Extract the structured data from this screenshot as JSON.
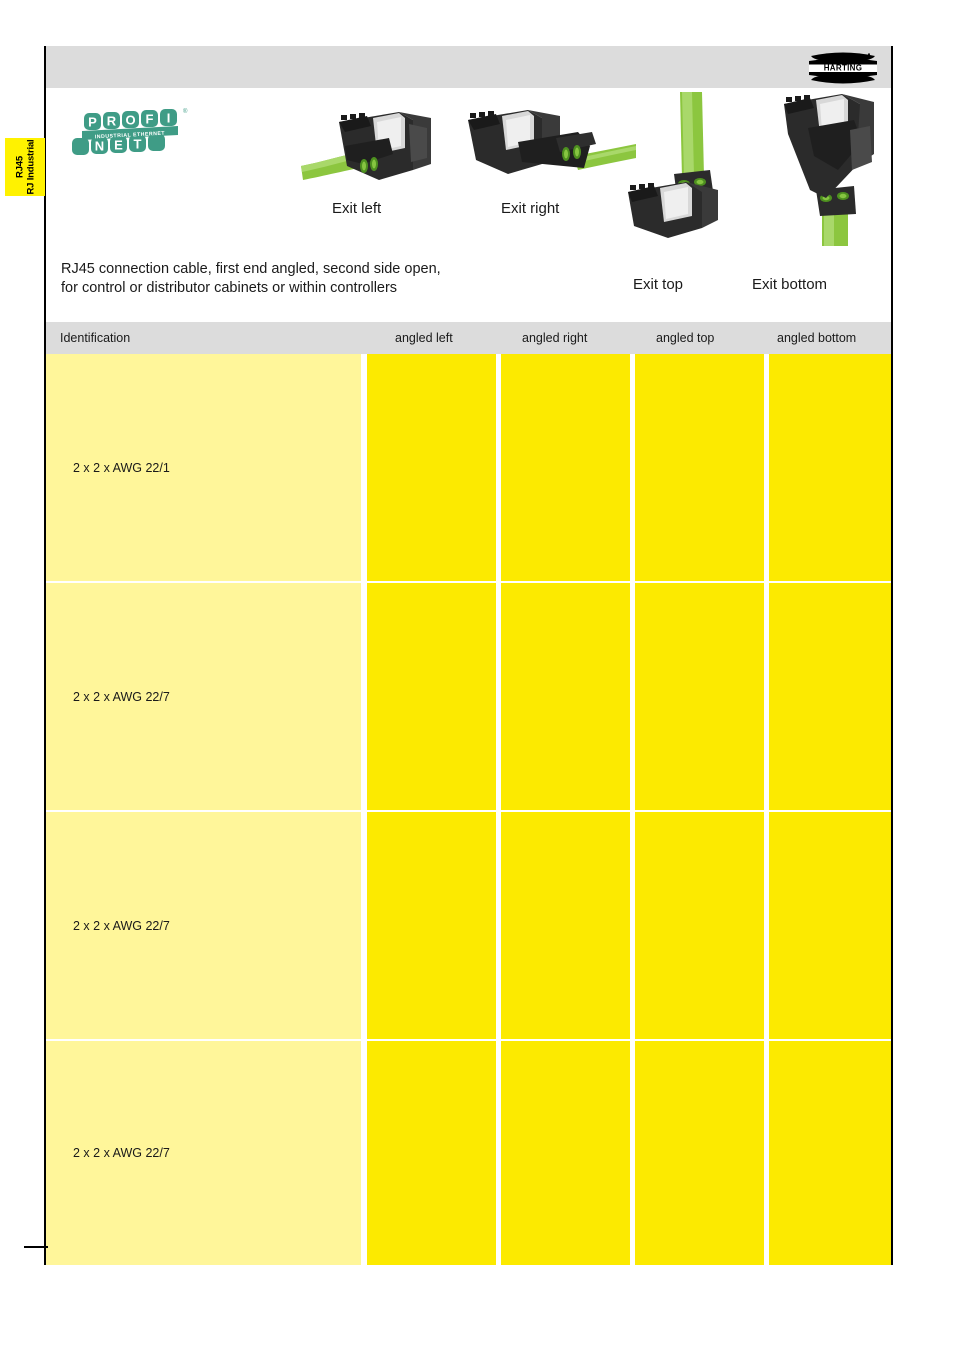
{
  "brand": {
    "logo_text": "HARTING",
    "accent_yellow": "#fcea00",
    "light_yellow": "#fff69a",
    "header_gray": "#dcdcdc",
    "profinet_green": "#3f9c86"
  },
  "side_tab": {
    "line1": "RJ45",
    "line2": "RJ Industrial"
  },
  "profinet": {
    "line1": "PROFI",
    "line2": "NET",
    "subtitle": "INDUSTRIAL ETHERNET",
    "registered_mark": "®",
    "letters_top": [
      "P",
      "R",
      "O",
      "F",
      "I"
    ],
    "letters_bottom": [
      "N",
      "E",
      "T"
    ]
  },
  "product": {
    "description_line1": "RJ45 connection cable, first end angled, second side open,",
    "description_line2": "for control or distributor cabinets or within controllers",
    "images": [
      {
        "name": "exit-left",
        "label": "Exit left"
      },
      {
        "name": "exit-right",
        "label": "Exit right"
      },
      {
        "name": "exit-top",
        "label": "Exit top"
      },
      {
        "name": "exit-bottom",
        "label": "Exit bottom"
      }
    ]
  },
  "table": {
    "headers": [
      "Identification",
      "angled left",
      "angled right",
      "angled top",
      "angled bottom"
    ],
    "rows": [
      {
        "identification": "2 x 2 x AWG 22/1",
        "angled_left": "",
        "angled_right": "",
        "angled_top": "",
        "angled_bottom": ""
      },
      {
        "identification": "2 x 2 x AWG 22/7",
        "angled_left": "",
        "angled_right": "",
        "angled_top": "",
        "angled_bottom": ""
      },
      {
        "identification": "2 x 2 x AWG 22/7",
        "angled_left": "",
        "angled_right": "",
        "angled_top": "",
        "angled_bottom": ""
      },
      {
        "identification": "2 x 2 x AWG 22/7",
        "angled_left": "",
        "angled_right": "",
        "angled_top": "",
        "angled_bottom": ""
      }
    ]
  }
}
